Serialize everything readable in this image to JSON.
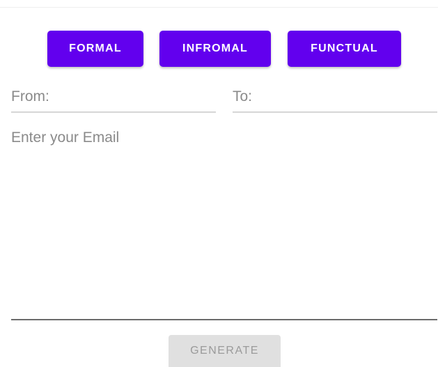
{
  "style_buttons": {
    "formal_label": "FORMAL",
    "infromal_label": "INFROMAL",
    "functual_label": "FUNCTUAL"
  },
  "fields": {
    "from": {
      "placeholder": "From:",
      "value": ""
    },
    "to": {
      "placeholder": "To:",
      "value": ""
    },
    "email": {
      "placeholder": "Enter your Email",
      "value": ""
    }
  },
  "actions": {
    "generate_label": "GENERATE",
    "generate_enabled": false
  },
  "colors": {
    "accent": "#6200ee",
    "button_text": "#ffffff",
    "disabled_bg": "#e0e0e0",
    "disabled_text": "#9a9a9a",
    "placeholder": "#8a8a8a"
  }
}
